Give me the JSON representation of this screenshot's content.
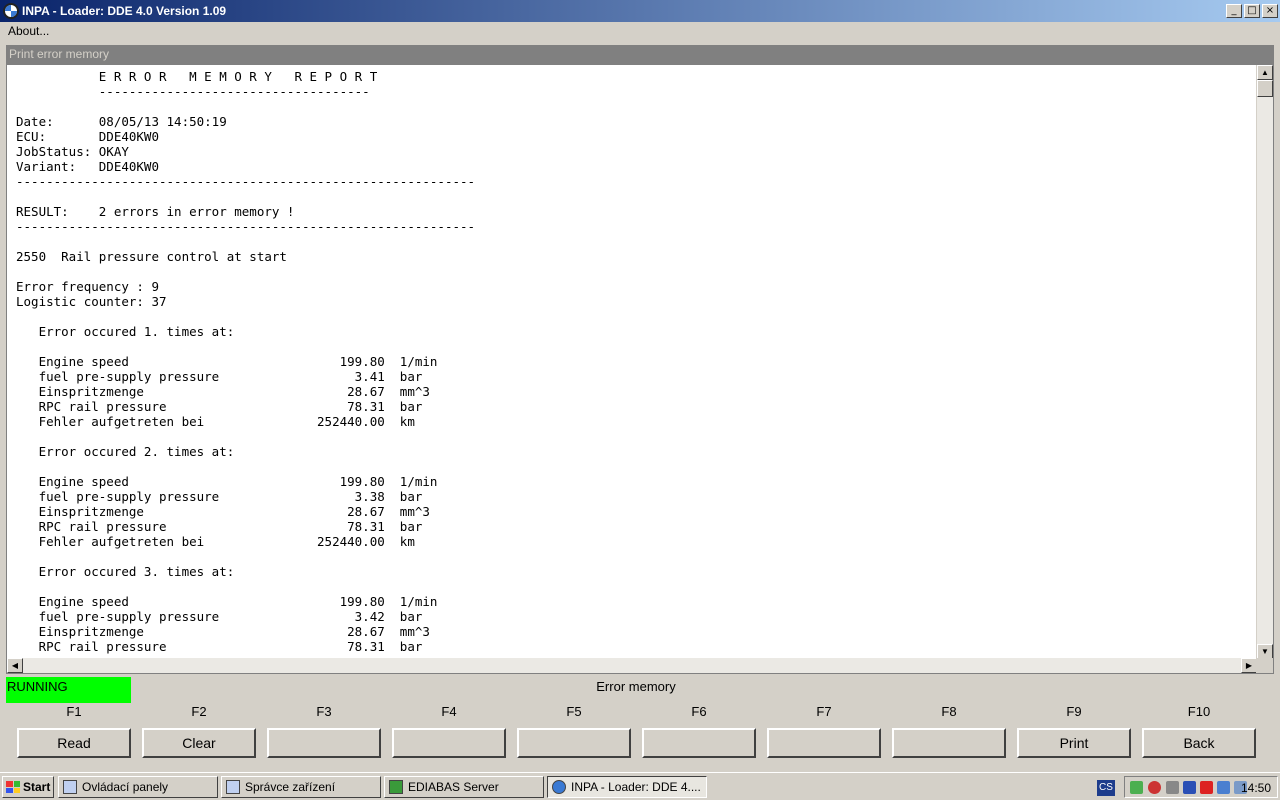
{
  "window": {
    "title": "INPA - Loader: DDE 4.0 Version 1.09",
    "minimize": "_",
    "maximize": "□",
    "close": "×"
  },
  "menu": {
    "about": "About..."
  },
  "panel": {
    "title": "Print error memory"
  },
  "report": {
    "lines": [
      "           E R R O R   M E M O R Y   R E P O R T",
      "           ------------------------------------",
      "",
      "Date:      08/05/13 14:50:19",
      "ECU:       DDE40KW0",
      "JobStatus: OKAY",
      "Variant:   DDE40KW0",
      "-------------------------------------------------------------",
      "",
      "RESULT:    2 errors in error memory !",
      "-------------------------------------------------------------",
      "",
      "2550  Rail pressure control at start",
      "",
      "Error frequency : 9",
      "Logistic counter: 37",
      "",
      "   Error occured 1. times at:",
      "",
      "   Engine speed                            199.80  1/min",
      "   fuel pre-supply pressure                  3.41  bar",
      "   Einspritzmenge                           28.67  mm^3",
      "   RPC rail pressure                        78.31  bar",
      "   Fehler aufgetreten bei               252440.00  km",
      "",
      "   Error occured 2. times at:",
      "",
      "   Engine speed                            199.80  1/min",
      "   fuel pre-supply pressure                  3.38  bar",
      "   Einspritzmenge                           28.67  mm^3",
      "   RPC rail pressure                        78.31  bar",
      "   Fehler aufgetreten bei               252440.00  km",
      "",
      "   Error occured 3. times at:",
      "",
      "   Engine speed                            199.80  1/min",
      "   fuel pre-supply pressure                  3.42  bar",
      "   Einspritzmenge                           28.67  mm^3",
      "   RPC rail pressure                        78.31  bar"
    ]
  },
  "scroll": {
    "up": "▲",
    "down": "▼",
    "left": "◀",
    "right": "▶"
  },
  "status": {
    "state": "RUNNING",
    "state_color": "#00ff00",
    "title": "Error memory"
  },
  "fkeys": [
    {
      "key": "F1",
      "label": "Read"
    },
    {
      "key": "F2",
      "label": "Clear"
    },
    {
      "key": "F3",
      "label": ""
    },
    {
      "key": "F4",
      "label": ""
    },
    {
      "key": "F5",
      "label": ""
    },
    {
      "key": "F6",
      "label": ""
    },
    {
      "key": "F7",
      "label": ""
    },
    {
      "key": "F8",
      "label": ""
    },
    {
      "key": "F9",
      "label": "Print"
    },
    {
      "key": "F10",
      "label": "Back"
    }
  ],
  "taskbar": {
    "start": "Start",
    "tasks": [
      {
        "label": "Ovládací panely",
        "icon": "control-panel-icon"
      },
      {
        "label": "Správce zařízení",
        "icon": "device-manager-icon"
      },
      {
        "label": "EDIABAS Server",
        "icon": "ediabas-icon"
      },
      {
        "label": "INPA - Loader:  DDE 4....",
        "icon": "inpa-icon"
      }
    ],
    "language": "CS",
    "clock": "14:50"
  }
}
